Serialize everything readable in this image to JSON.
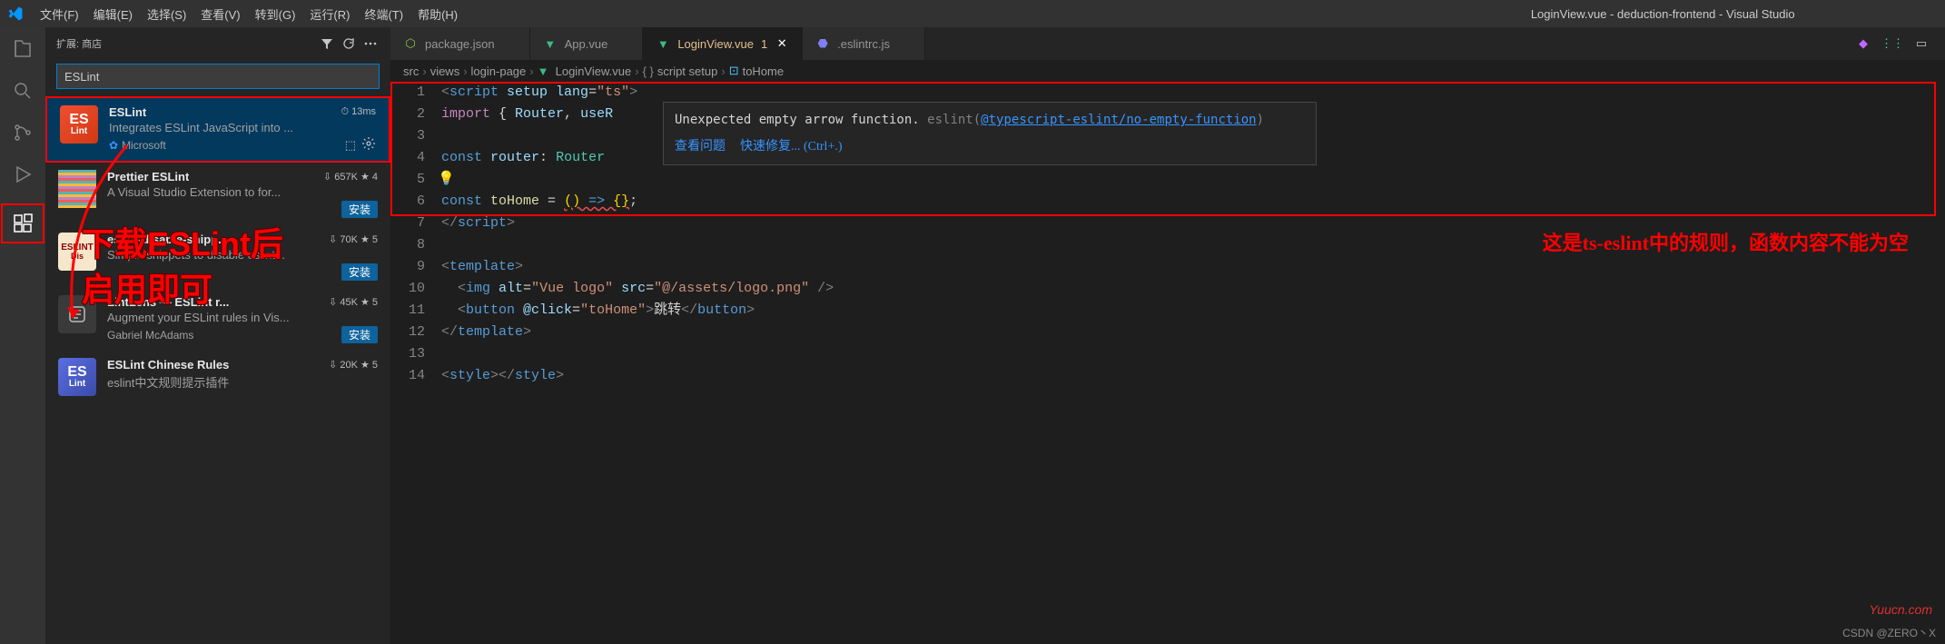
{
  "menu": [
    "文件(F)",
    "编辑(E)",
    "选择(S)",
    "查看(V)",
    "转到(G)",
    "运行(R)",
    "终端(T)",
    "帮助(H)"
  ],
  "window_title": "LoginView.vue - deduction-frontend - Visual Studio",
  "sidebar": {
    "header_label": "扩展: 商店",
    "search_value": "ESLint"
  },
  "extensions": [
    {
      "name": "ESLint",
      "meta": "⏱ 13ms",
      "desc": "Integrates ESLint JavaScript into ...",
      "publisher": "Microsoft",
      "verified": true,
      "selected": true,
      "icon_bg": "linear-gradient(135deg,#f04e30,#d13913)",
      "icon_text": "ES",
      "icon_sub": "Lint",
      "install": false,
      "gear": true
    },
    {
      "name": "Prettier ESLint",
      "meta": "⇩ 657K ★ 4",
      "desc": "A Visual Studio Extension to for...",
      "publisher": "",
      "install": true,
      "icon_bg": "#1b1b2f",
      "icon_img": "prettier"
    },
    {
      "name": "eslint-disable-snipp...",
      "meta": "⇩ 70K ★ 5",
      "desc": "Simple snippets to disable eslint...",
      "publisher": "",
      "install": true,
      "icon_bg": "#f5e6cc",
      "icon_text": "ESLINT",
      "icon_text2": "Dis"
    },
    {
      "name": "LintLens — ESLint r...",
      "meta": "⇩ 45K ★ 5",
      "desc": "Augment your ESLint rules in Vis...",
      "publisher": "Gabriel McAdams",
      "install": true,
      "icon_bg": "#3a3a3a",
      "icon_svg": "lens"
    },
    {
      "name": "ESLint Chinese Rules",
      "meta": "⇩ 20K ★ 5",
      "desc": "eslint中文规则提示插件",
      "publisher": "",
      "install": false,
      "icon_bg": "linear-gradient(135deg,#5b6ee1,#3b4ba8)",
      "icon_text": "ES",
      "icon_sub": "Lint"
    }
  ],
  "tabs": [
    {
      "label": "package.json",
      "icon": "npm",
      "icon_color": "#8bc34a",
      "active": false
    },
    {
      "label": "App.vue",
      "icon": "vue",
      "icon_color": "#41b883",
      "active": false
    },
    {
      "label": "LoginView.vue",
      "icon": "vue",
      "icon_color": "#41b883",
      "active": true,
      "modified": "1"
    },
    {
      "label": ".eslintrc.js",
      "icon": "eslint",
      "icon_color": "#4b32c3",
      "active": false
    }
  ],
  "breadcrumb": [
    "src",
    "views",
    "login-page",
    "LoginView.vue",
    "script setup",
    "toHome"
  ],
  "code_lines": [
    "1",
    "2",
    "3",
    "4",
    "5",
    "6",
    "7",
    "8",
    "9",
    "10",
    "11",
    "12",
    "13",
    "14"
  ],
  "code": {
    "l1": {
      "a": "<",
      "b": "script",
      "c": " setup lang",
      "d": "=",
      "e": "\"ts\"",
      "f": ">"
    },
    "l2": {
      "a": "import",
      "b": " { ",
      "c": "Router",
      "d": ", ",
      "e": "useR"
    },
    "l4": {
      "a": "const",
      "b": " ",
      "c": "router",
      "d": ": ",
      "e": "Router"
    },
    "l6": {
      "a": "const",
      "b": " ",
      "c": "toHome",
      "d": " = ",
      "e": "()",
      "f": " => ",
      "g": "{}",
      "h": ";"
    },
    "l7": {
      "a": "</",
      "b": "script",
      "c": ">"
    },
    "l9": {
      "a": "<",
      "b": "template",
      "c": ">"
    },
    "l10": {
      "a": "  <",
      "b": "img",
      "c": " alt",
      "d": "=",
      "e": "\"Vue logo\"",
      "f": " src",
      "g": "=",
      "h": "\"@/assets/logo.png\"",
      "i": " />"
    },
    "l11": {
      "a": "  <",
      "b": "button",
      "c": " @click",
      "d": "=",
      "e": "\"toHome\"",
      "f": ">",
      "g": "跳转",
      "h": "</",
      "i": "button",
      "j": ">"
    },
    "l12": {
      "a": "</",
      "b": "template",
      "c": ">"
    },
    "l14": {
      "a": "<",
      "b": "style",
      "c": "></",
      "d": "style",
      "e": ">"
    }
  },
  "hover": {
    "msg1": "Unexpected empty arrow function. ",
    "msg2": "eslint(",
    "link": "@typescript-eslint/no-empty-function",
    "msg3": ")",
    "action1": "查看问题",
    "action2": "快速修复... (Ctrl+.)"
  },
  "overlay_text1": "下载ESLint后",
  "overlay_text2": "启用即可",
  "annotation_text": "这是ts-eslint中的规则，函数内容不能为空",
  "watermark": "Yuucn.com",
  "footer": "CSDN @ZERO丶X"
}
